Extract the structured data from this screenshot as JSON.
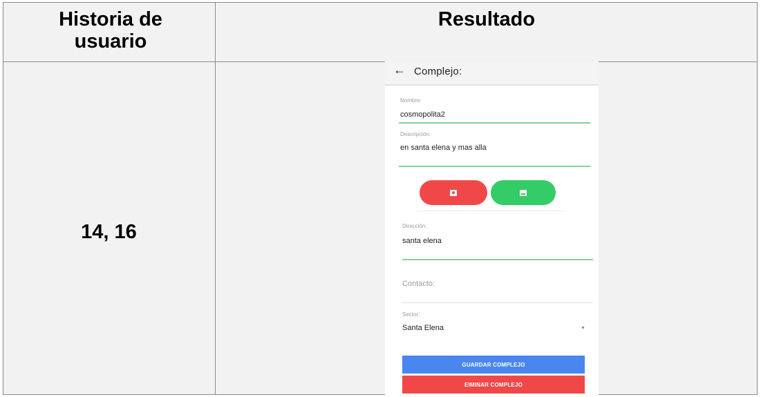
{
  "table": {
    "header_col1": "Historia de usuario",
    "header_col2": "Resultado",
    "story_numbers": "14, 16"
  },
  "app": {
    "title": "Complejo:",
    "back_icon": "arrow-left-icon",
    "fields": {
      "nombre": {
        "label": "Nombre:",
        "value": "cosmopolita2"
      },
      "descripcion": {
        "label": "Descripción:",
        "value": "en santa elena y mas alla"
      },
      "direccion": {
        "label": "Dirección:",
        "value": "santa elena"
      },
      "contacto": {
        "placeholder": "Contacto:"
      },
      "sector": {
        "label": "Sector:",
        "value": "Santa Elena"
      }
    },
    "photo_buttons": {
      "camera_icon": "camera-icon",
      "gallery_icon": "image-icon",
      "camera_color": "#f04848",
      "gallery_color": "#33cc66"
    },
    "actions": {
      "save_label": "GUARDAR COMPLEJO",
      "delete_label": "EIMINAR COMPLEJO",
      "save_color": "#4a86f0",
      "delete_color": "#f04848"
    },
    "accent_color": "#7fd49a"
  }
}
